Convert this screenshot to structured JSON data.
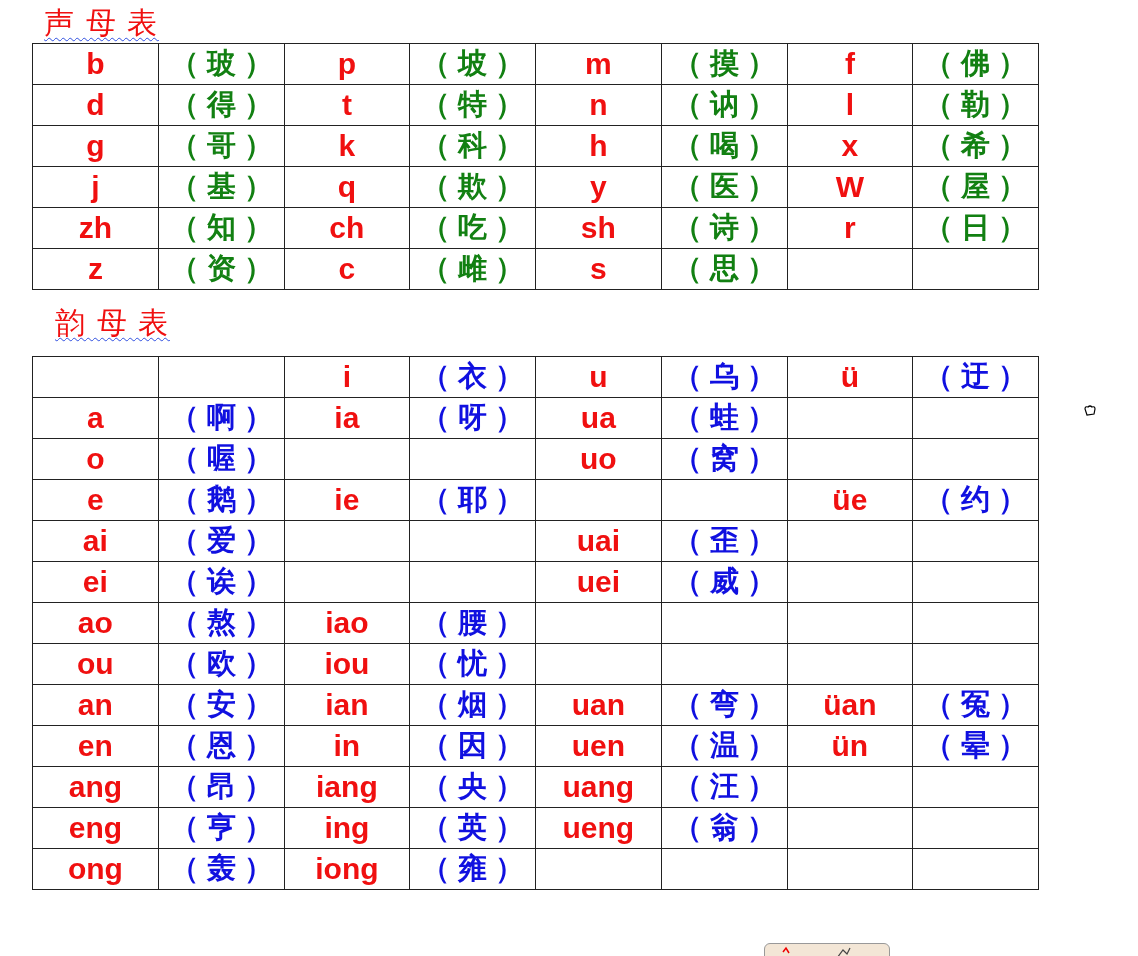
{
  "initials": {
    "title": "声 母 表",
    "color": "#128012",
    "rows": [
      [
        "b",
        "（ 玻 ）",
        "p",
        "（ 坡 ）",
        "m",
        "（ 摸 ）",
        "f",
        "（ 佛 ）"
      ],
      [
        "d",
        "（ 得 ）",
        "t",
        "（ 特 ）",
        "n",
        "（ 讷 ）",
        "l",
        "（ 勒 ）"
      ],
      [
        "g",
        "（ 哥 ）",
        "k",
        "（ 科 ）",
        "h",
        "（ 喝 ）",
        "x",
        "（ 希 ）"
      ],
      [
        "j",
        "（ 基 ）",
        "q",
        "（ 欺 ）",
        "y",
        "（ 医 ）",
        "W",
        "（ 屋 ）"
      ],
      [
        "zh",
        "（ 知 ）",
        "ch",
        "（ 吃 ）",
        "sh",
        "（ 诗 ）",
        "r",
        "（ 日 ）"
      ],
      [
        "z",
        "（ 资 ）",
        "c",
        "（ 雌 ）",
        "s",
        "（ 思 ）",
        null,
        null
      ]
    ]
  },
  "finals": {
    "title": "韵 母 表",
    "color": "#1010e0",
    "rows": [
      [
        null,
        null,
        "i",
        "（ 衣 ）",
        "u",
        "（ 乌 ）",
        "ü",
        "（ 迂 ）"
      ],
      [
        "a",
        "（ 啊 ）",
        "ia",
        "（ 呀 ）",
        "ua",
        "（ 蛙 ）",
        null,
        null
      ],
      [
        "o",
        "（ 喔 ）",
        null,
        null,
        "uo",
        "（ 窝 ）",
        null,
        null
      ],
      [
        "e",
        "（ 鹅 ）",
        "ie",
        "（ 耶 ）",
        null,
        null,
        "üe",
        "（ 约 ）"
      ],
      [
        "ai",
        "（ 爱 ）",
        null,
        null,
        "uai",
        "（ 歪 ）",
        null,
        null
      ],
      [
        "ei",
        "（ 诶 ）",
        null,
        null,
        "uei",
        "（ 威 ）",
        null,
        null
      ],
      [
        "ao",
        "（ 熬 ）",
        "iao",
        "（ 腰 ）",
        null,
        null,
        null,
        null
      ],
      [
        "ou",
        "（ 欧 ）",
        "iou",
        "（ 忧 ）",
        null,
        null,
        null,
        null
      ],
      [
        "an",
        "（ 安 ）",
        "ian",
        "（ 烟 ）",
        "uan",
        "（ 弯 ）",
        "üan",
        "（ 冤 ）"
      ],
      [
        "en",
        "（ 恩 ）",
        "in",
        "（ 因 ）",
        "uen",
        "（ 温 ）",
        "ün",
        "（ 晕 ）"
      ],
      [
        "ang",
        "（ 昂 ）",
        "iang",
        "（ 央 ）",
        "uang",
        "（ 汪 ）",
        null,
        null
      ],
      [
        "eng",
        "（ 亨 ）",
        "ing",
        "（ 英 ）",
        "ueng",
        "（ 翁 ）",
        null,
        null
      ],
      [
        "ong",
        "（ 轰 ）",
        "iong",
        "（ 雍 ）",
        null,
        null,
        null,
        null
      ]
    ]
  }
}
